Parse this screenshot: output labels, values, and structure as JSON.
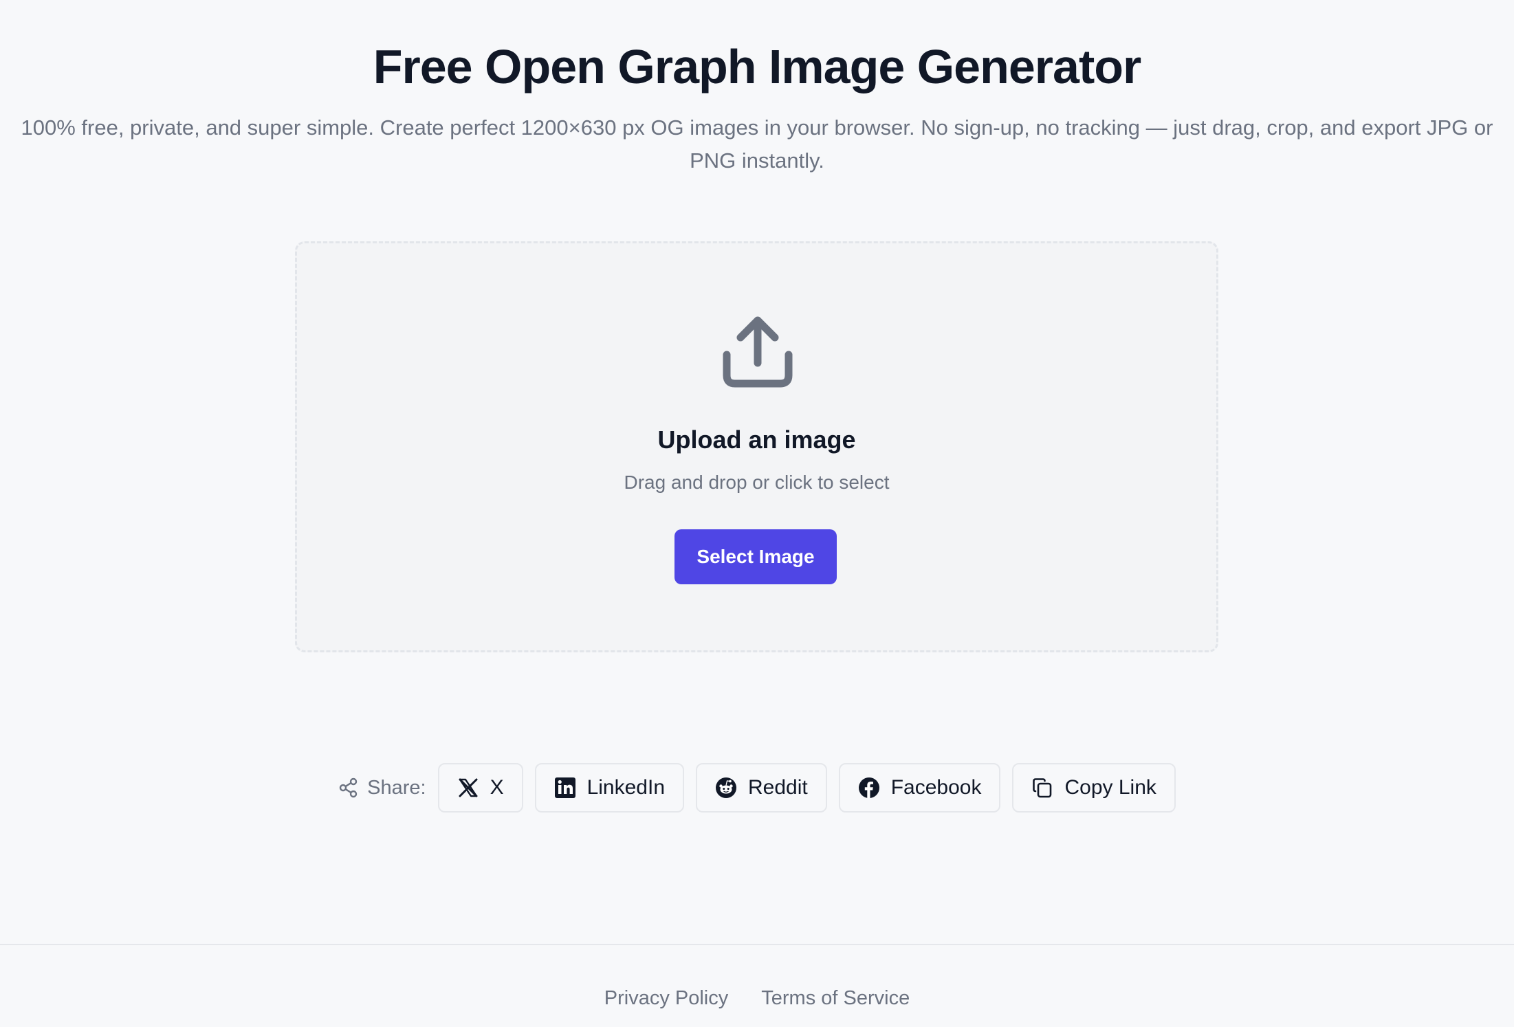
{
  "hero": {
    "title": "Free Open Graph Image Generator",
    "subtitle": "100% free, private, and super simple. Create perfect 1200×630 px OG images in your browser. No sign-up, no tracking — just drag, crop, and export JPG or PNG instantly."
  },
  "dropzone": {
    "icon": "upload-icon",
    "title": "Upload an image",
    "subtitle": "Drag and drop or click to select",
    "button_label": "Select Image"
  },
  "share": {
    "label": "Share:",
    "buttons": [
      {
        "label": "X",
        "icon": "x-icon"
      },
      {
        "label": "LinkedIn",
        "icon": "linkedin-icon"
      },
      {
        "label": "Reddit",
        "icon": "reddit-icon"
      },
      {
        "label": "Facebook",
        "icon": "facebook-icon"
      },
      {
        "label": "Copy Link",
        "icon": "copy-icon"
      }
    ]
  },
  "footer": {
    "links": [
      "Privacy Policy",
      "Terms of Service"
    ]
  },
  "colors": {
    "accent": "#4f46e5",
    "background": "#f7f8fa",
    "text": "#111827",
    "muted": "#6b7280"
  }
}
